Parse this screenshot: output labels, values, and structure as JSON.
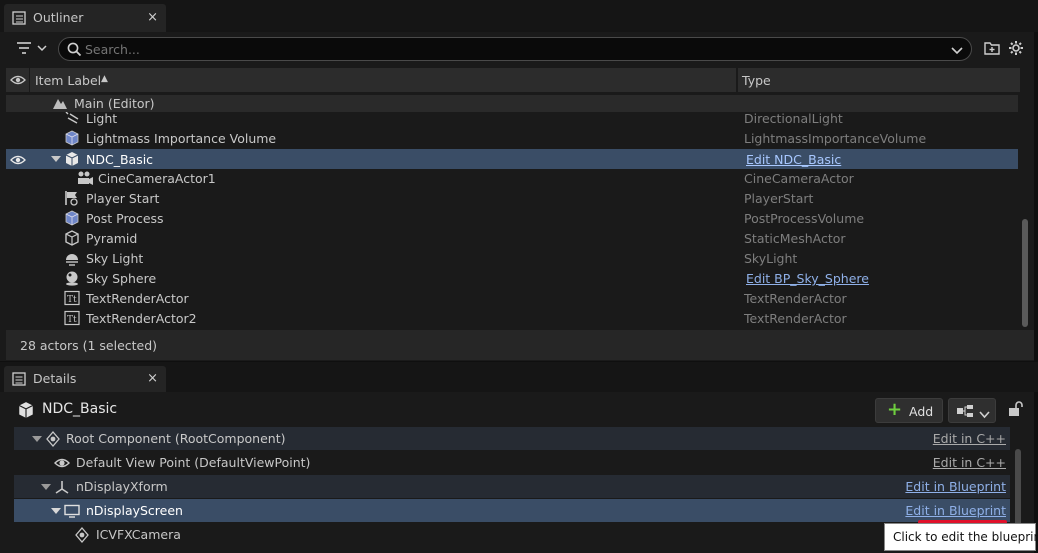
{
  "outliner": {
    "tab_title": "Outliner",
    "close_glyph": "×",
    "search_placeholder": "Search...",
    "columns": {
      "label": "Item Label",
      "type": "Type"
    },
    "sort_glyph": "▲",
    "rows": [
      {
        "label": "Main (Editor)",
        "type": "",
        "icon": "world-icon"
      },
      {
        "label": "Light",
        "type": "DirectionalLight",
        "icon": "directional-light-icon"
      },
      {
        "label": "Lightmass Importance Volume",
        "type": "LightmassImportanceVolume",
        "icon": "volume-icon"
      },
      {
        "label": "NDC_Basic",
        "type": "Edit NDC_Basic",
        "icon": "ndisplay-actor-icon",
        "selected": true
      },
      {
        "label": "CineCameraActor1",
        "type": "CineCameraActor",
        "icon": "camera-icon"
      },
      {
        "label": "Player Start",
        "type": "PlayerStart",
        "icon": "player-start-icon"
      },
      {
        "label": "Post Process",
        "type": "PostProcessVolume",
        "icon": "volume-icon"
      },
      {
        "label": "Pyramid",
        "type": "StaticMeshActor",
        "icon": "static-mesh-icon"
      },
      {
        "label": "Sky Light",
        "type": "SkyLight",
        "icon": "sky-light-icon"
      },
      {
        "label": "Sky Sphere",
        "type": "Edit BP_Sky_Sphere",
        "icon": "sky-sphere-icon"
      },
      {
        "label": "TextRenderActor",
        "type": "TextRenderActor",
        "icon": "text-render-icon"
      },
      {
        "label": "TextRenderActor2",
        "type": "TextRenderActor",
        "icon": "text-render-icon"
      }
    ],
    "status": "28 actors (1 selected)"
  },
  "details": {
    "tab_title": "Details",
    "close_glyph": "×",
    "actor_name": "NDC_Basic",
    "add_label": "Add",
    "add_glyph": "+",
    "components": [
      {
        "label": "Root Component (RootComponent)",
        "link": "Edit in C++",
        "icon": "scene-component-icon"
      },
      {
        "label": "Default View Point (DefaultViewPoint)",
        "link": "Edit in C++",
        "icon": "view-point-icon"
      },
      {
        "label": "nDisplayXform",
        "link": "Edit in Blueprint",
        "icon": "xform-icon"
      },
      {
        "label": "nDisplayScreen",
        "link": "Edit in Blueprint",
        "icon": "screen-icon",
        "selected": true
      },
      {
        "label": "ICVFXCamera",
        "link": "",
        "icon": "icvfx-camera-icon"
      }
    ],
    "tooltip": "Click to edit the blueprint"
  },
  "colors": {
    "selection": "#3a4d66",
    "link": "#8fb0e8",
    "annotation": "#e0102a",
    "add_plus": "#6fcf3f"
  }
}
